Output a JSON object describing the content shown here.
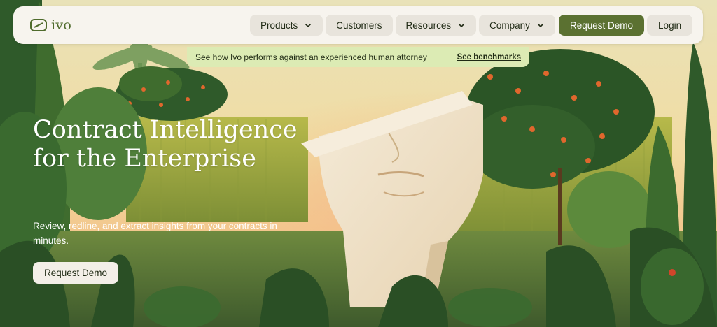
{
  "nav": {
    "logo_text": "ivo",
    "items": [
      {
        "label": "Products",
        "has_dropdown": true
      },
      {
        "label": "Customers",
        "has_dropdown": false
      },
      {
        "label": "Resources",
        "has_dropdown": true
      },
      {
        "label": "Company",
        "has_dropdown": true
      }
    ],
    "demo_label": "Request Demo",
    "login_label": "Login"
  },
  "banner": {
    "text": "See how Ivo performs against an experienced human attorney",
    "link": "See benchmarks"
  },
  "hero": {
    "headline": "Contract Intelligence for the Enterprise",
    "subheadline": "Review, redline, and extract insights from your contracts in minutes.",
    "cta_label": "Request Demo"
  },
  "colors": {
    "brand_green": "#5b7131",
    "banner_bg": "#dcebb4",
    "nav_bg": "#f7f4ee"
  }
}
